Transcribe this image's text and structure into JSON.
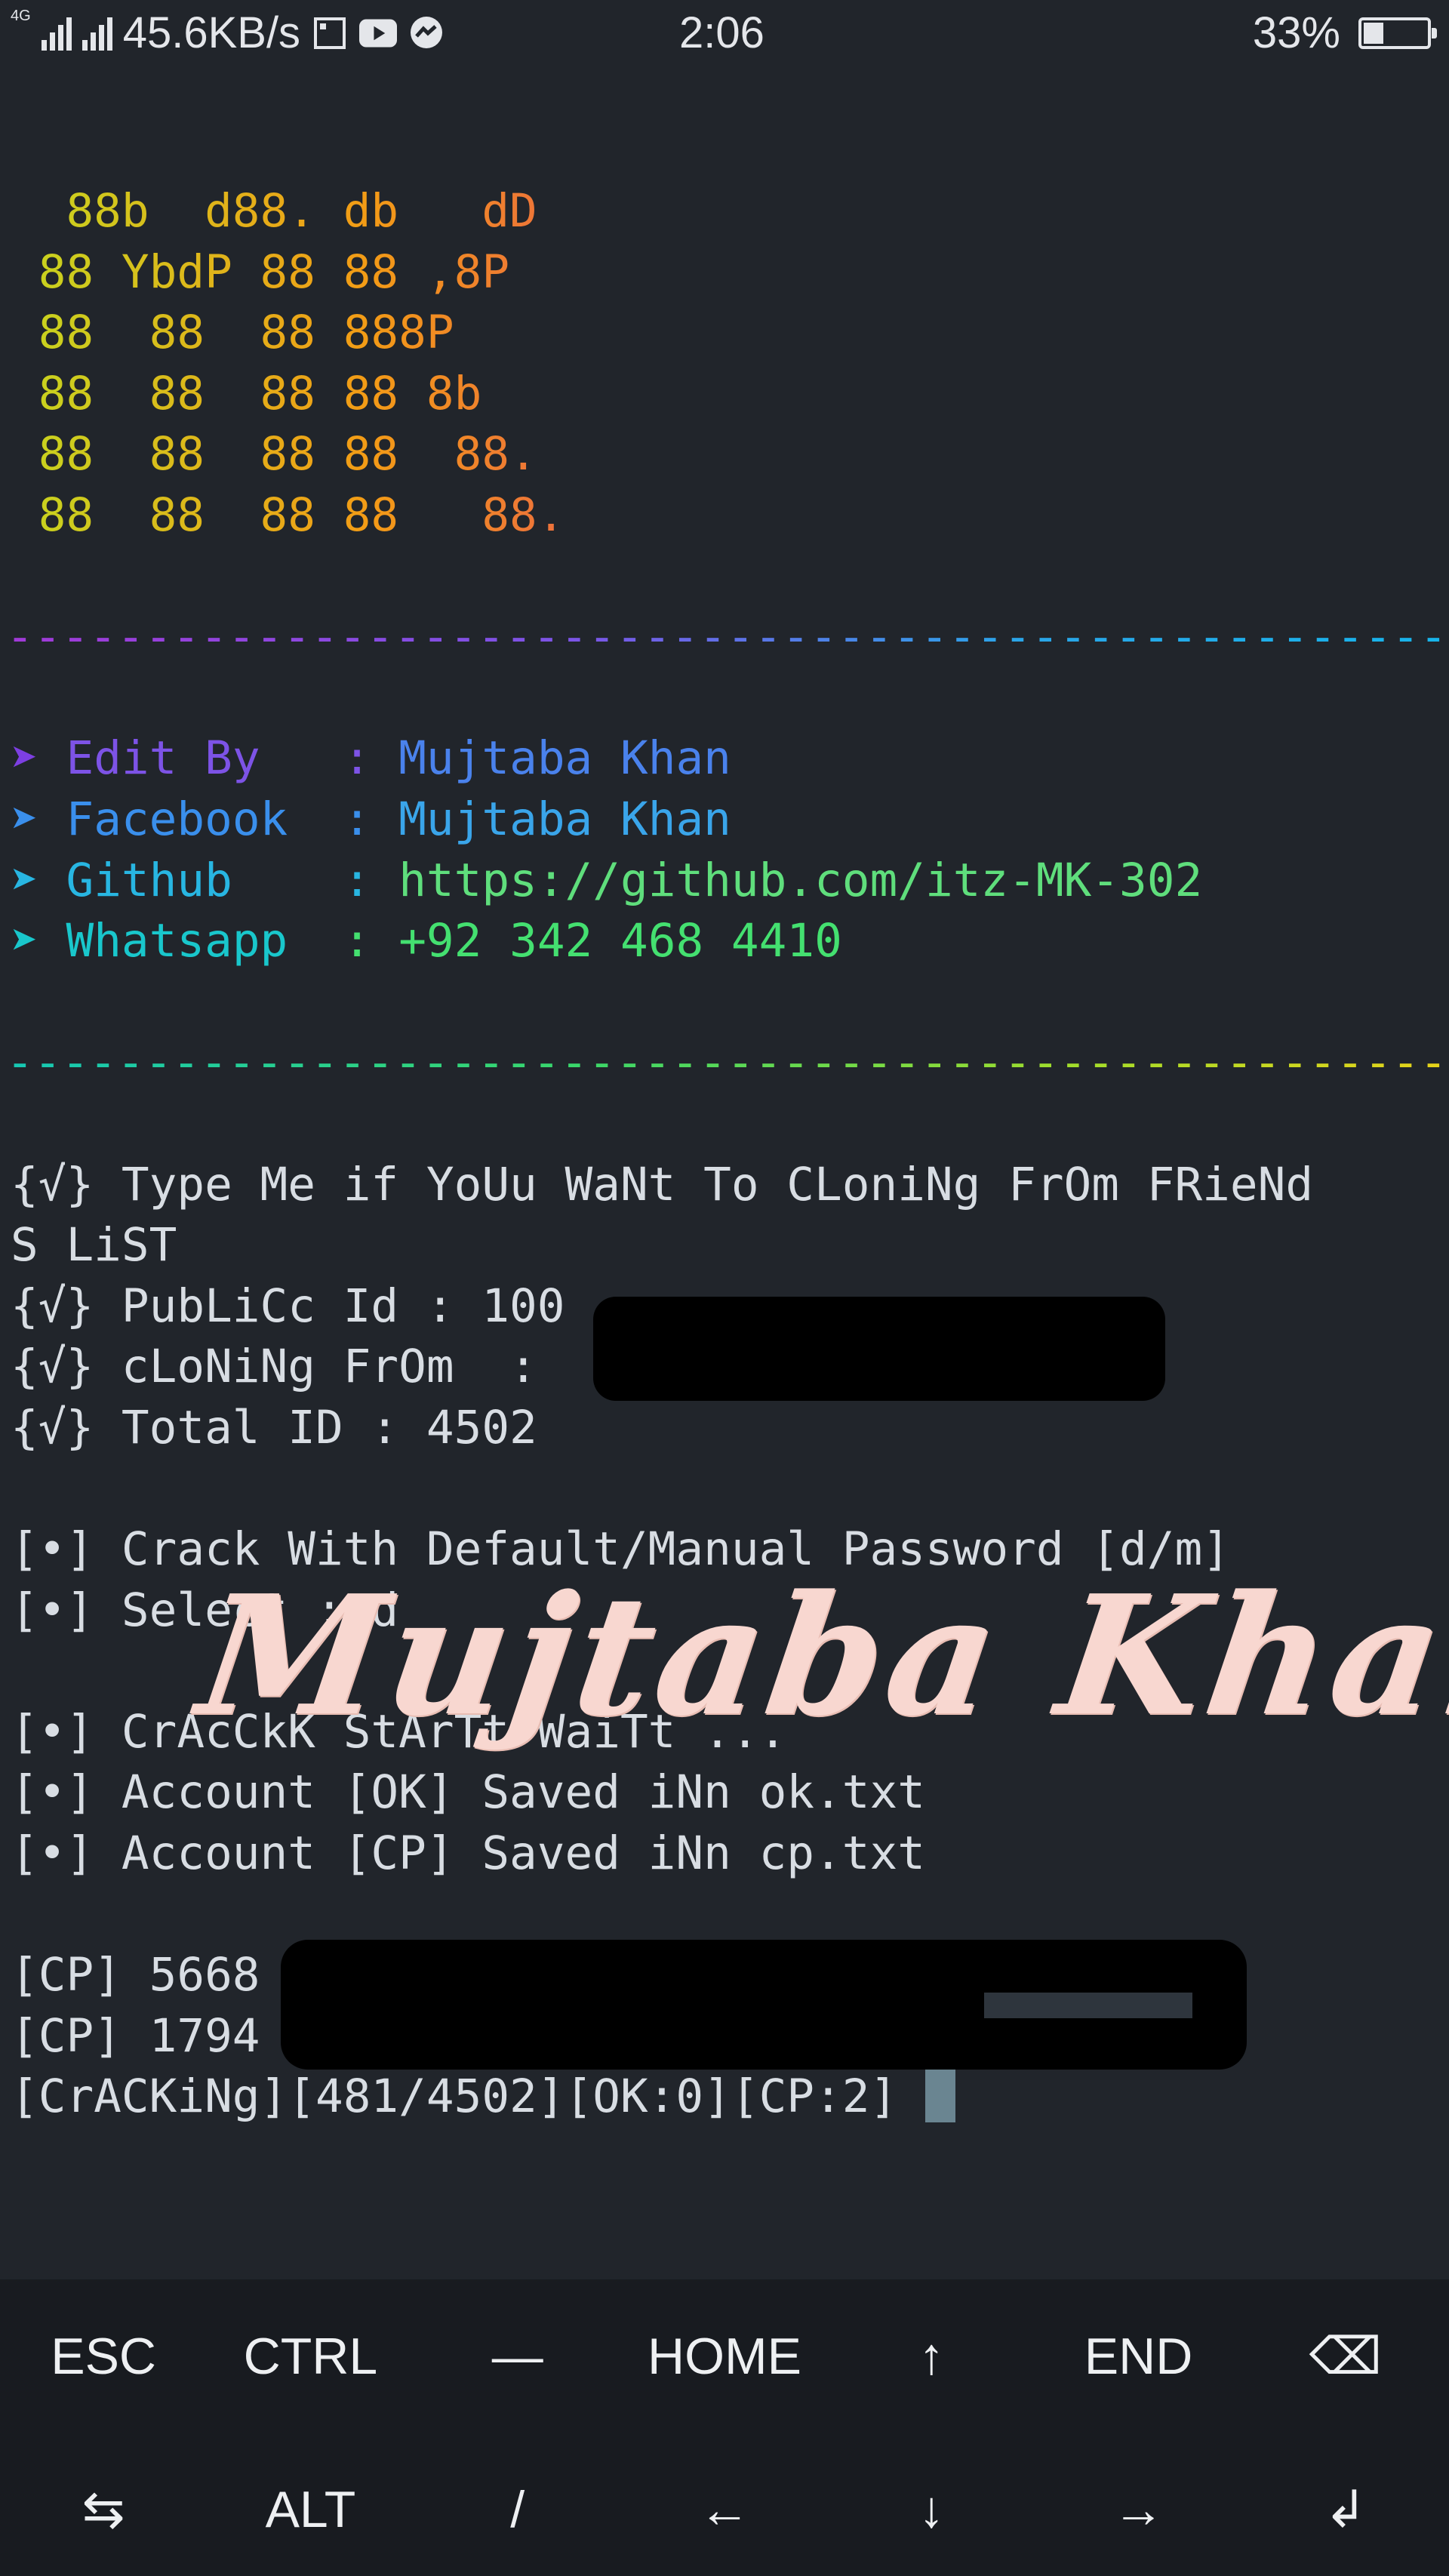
{
  "status_bar": {
    "network_type": "4G",
    "speed": "45.6KB/s",
    "time": "2:06",
    "battery": "33%",
    "notification_icons": [
      "screenshot-icon",
      "youtube-icon",
      "messenger-icon"
    ]
  },
  "banner": [
    "  88b  d88. db   dD",
    " 88 YbdP 88 88 ,8P",
    " 88  88  88 888P",
    " 88  88  88 88 8b",
    " 88  88  88 88  88.",
    " 88  88  88 88   88."
  ],
  "divider": "------------------------------------------------------------",
  "info": [
    {
      "label": "Edit By  ",
      "value": "Mujtaba Khan"
    },
    {
      "label": "Facebook ",
      "value": "Mujtaba Khan"
    },
    {
      "label": "Github   ",
      "value": "https://github.com/itz-MK-302"
    },
    {
      "label": "Whatsapp ",
      "value": "+92 342 468 4410"
    }
  ],
  "arrow": "➤",
  "output": {
    "type_me_1": "{√} Type Me if YoUu WaNt To CLoniNg FrOm FRieNd",
    "type_me_2": "S LiST",
    "public_id": "{√} PubLiCc Id : 100",
    "cloning_from": "{√} cLoNiNg FrOm  :",
    "total_id": "{√} Total ID : 4502",
    "crack_with": "[•] Crack With Default/Manual Password [d/m]",
    "select": "[•] Select : d",
    "crack_start": "[•] CrAcCkK StArTt WaiTt ...",
    "ok_saved": "[•] Account [OK] Saved iNn ok.txt",
    "cp_saved": "[•] Account [CP] Saved iNn cp.txt",
    "cp1": "[CP] 5668",
    "cp2": "[CP] 1794",
    "progress": "[CrACKiNg][481/4502][OK:0][CP:2] "
  },
  "watermark": "Mujtaba Khan",
  "extra_keys": {
    "row1": [
      "ESC",
      "CTRL",
      "—",
      "HOME",
      "↑",
      "END",
      "⌫"
    ],
    "row2": [
      "⇆",
      "ALT",
      "/",
      "←",
      "↓",
      "→",
      "↲"
    ]
  }
}
